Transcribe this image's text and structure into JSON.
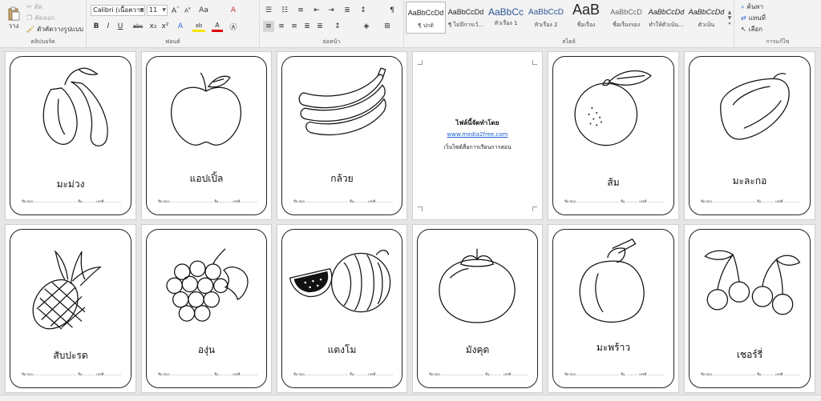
{
  "ribbon": {
    "clipboard": {
      "paste": "วาง",
      "cut": "ตัด",
      "copy": "คัดลอก",
      "format_painter": "ตัวคัดวางรูปแบบ",
      "label": "คลิปบอร์ด"
    },
    "font": {
      "font_name": "Calibri (เนื้อความ",
      "font_size": "11",
      "change_case": "Aa",
      "bold": "B",
      "italic": "I",
      "underline": "U",
      "strike": "abc",
      "subscript": "x₂",
      "superscript": "x²",
      "effects": "A",
      "highlight": "ab",
      "color": "A",
      "label": "ฟอนต์"
    },
    "paragraph": {
      "label": "ย่อหน้า",
      "show_marks": "¶"
    },
    "styles": {
      "label": "สไตล์",
      "items": [
        {
          "sample": "AaBbCcDd",
          "name": "¶ ปกติ"
        },
        {
          "sample": "AaBbCcDd",
          "name": "¶ ไม่มีการเว้..."
        },
        {
          "sample": "AaBbCc",
          "name": "หัวเรื่อง 1"
        },
        {
          "sample": "AaBbCcD",
          "name": "หัวเรื่อง 2"
        },
        {
          "sample": "AaB",
          "name": "ชื่อเรื่อง"
        },
        {
          "sample": "AaBbCcD",
          "name": "ชื่อเรื่องรอง"
        },
        {
          "sample": "AaBbCcDd",
          "name": "ทำให้ตัวเน้น..."
        },
        {
          "sample": "AaBbCcDd",
          "name": "ตัวเน้น"
        }
      ]
    },
    "editing": {
      "find": "ค้นหา",
      "replace": "แทนที่",
      "select": "เลือก",
      "label": "การแก้ไข"
    }
  },
  "cards": [
    {
      "name": "มะม่วง",
      "icon": "mango-drawing"
    },
    {
      "name": "แอปเปิ้ล",
      "icon": "apple-drawing"
    },
    {
      "name": "กล้วย",
      "icon": "banana-drawing"
    },
    {
      "name": "",
      "icon": ""
    },
    {
      "name": "ส้ม",
      "icon": "orange-drawing"
    },
    {
      "name": "มะละกอ",
      "icon": "papaya-drawing"
    },
    {
      "name": "สับปะรด",
      "icon": "pineapple-drawing"
    },
    {
      "name": "องุ่น",
      "icon": "grapes-drawing"
    },
    {
      "name": "แตงโม",
      "icon": "watermelon-drawing"
    },
    {
      "name": "มังคุด",
      "icon": "mangosteen-drawing"
    },
    {
      "name": "มะพร้าว",
      "icon": "coconut-drawing"
    },
    {
      "name": "เชอร์รี่",
      "icon": "cherry-drawing"
    }
  ],
  "fill_line": "ชื่อ-สกุล...........................................  ชั้น.............  เลขที่.................",
  "credit": {
    "title": "ไฟล์นี้จัดทำโดย",
    "link": "www.media2free.com",
    "desc": "เว็บไซต์สื่อการเรียนการสอน"
  }
}
